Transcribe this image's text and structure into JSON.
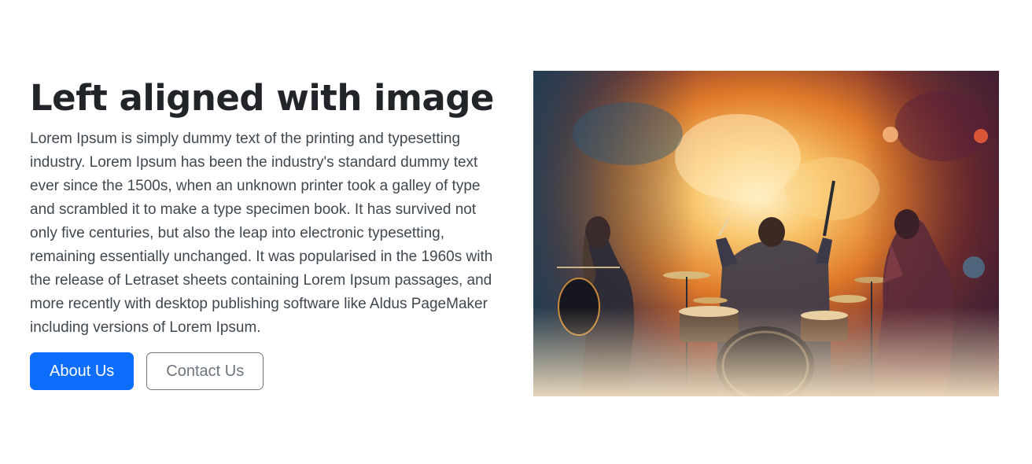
{
  "hero": {
    "title": "Left aligned with image",
    "body": "Lorem Ipsum is simply dummy text of the printing and typesetting industry. Lorem Ipsum has been the industry's standard dummy text ever since the 1500s, when an unknown printer took a galley of type and scrambled it to make a type specimen book. It has survived not only five centuries, but also the leap into electronic typesetting, remaining essentially unchanged. It was popularised in the 1960s with the release of Letraset sheets containing Lorem Ipsum passages, and more recently with desktop publishing software like Aldus PageMaker including versions of Lorem Ipsum.",
    "primary_button_label": "About Us",
    "secondary_button_label": "Contact Us",
    "image_alt": ""
  },
  "colors": {
    "primary": "#0d6efd",
    "outline": "#6c757d",
    "title_text": "#212529",
    "body_text": "#3f474f"
  }
}
